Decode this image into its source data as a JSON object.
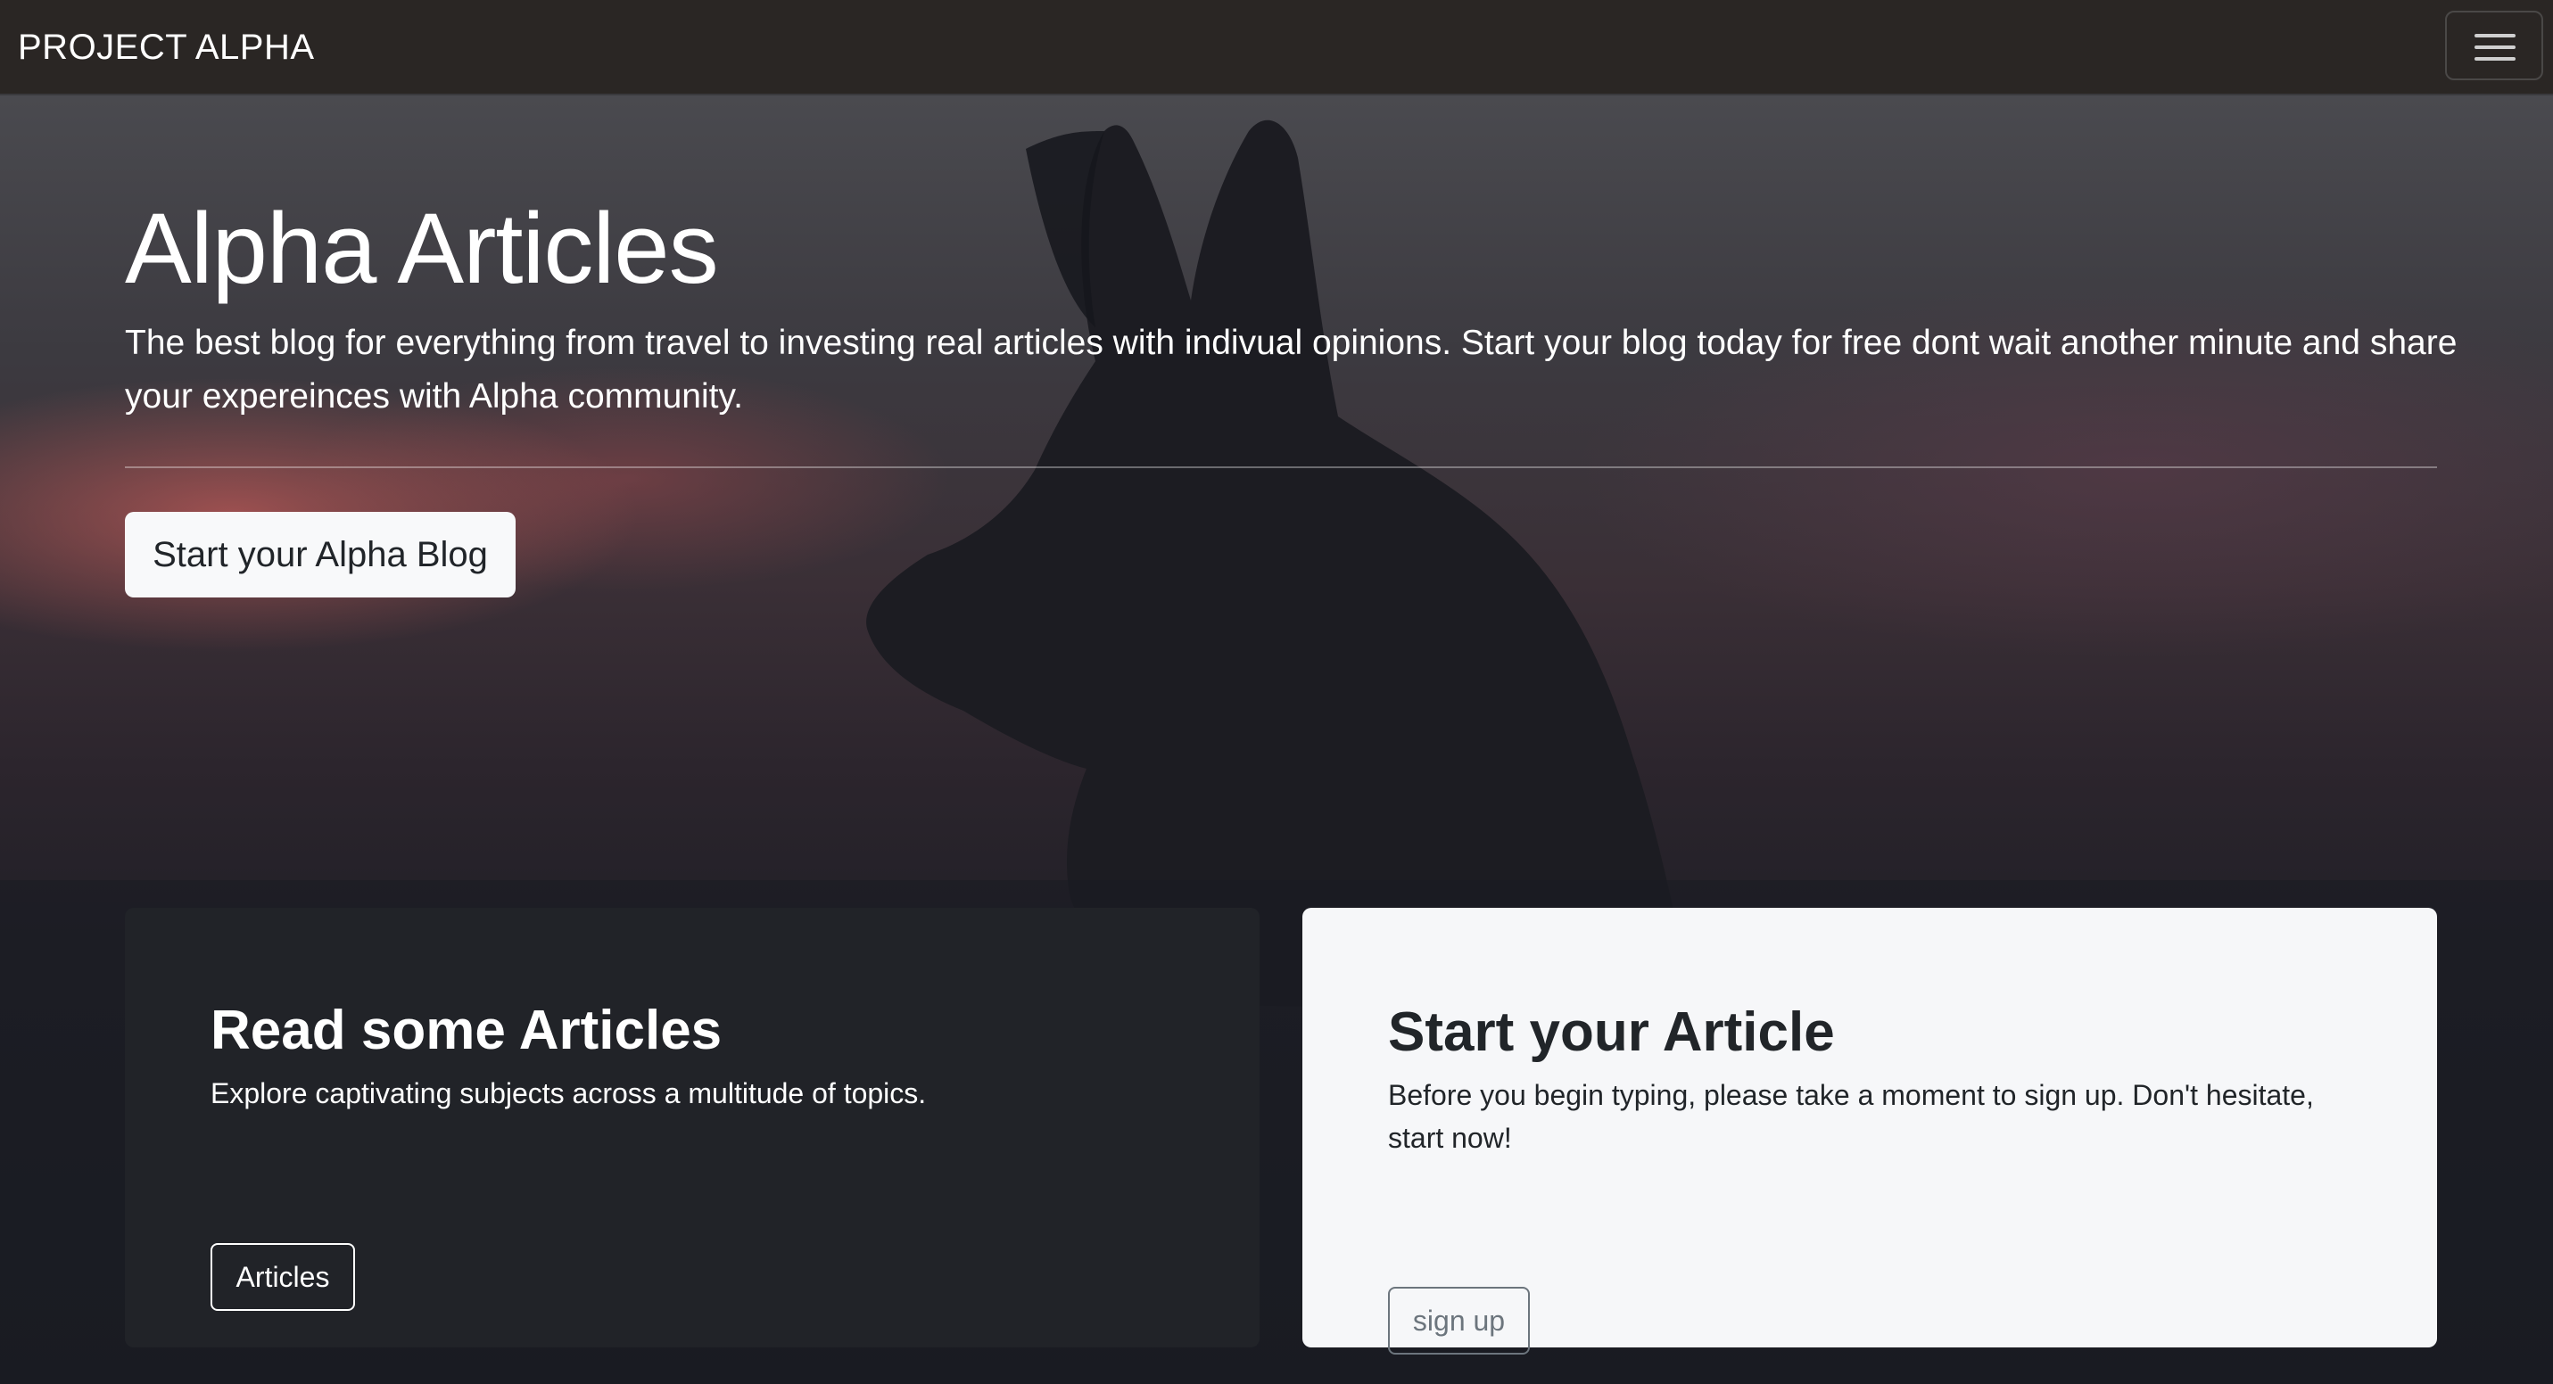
{
  "navbar": {
    "brand": "PROJECT ALPHA",
    "menu_icon": "hamburger-menu-icon"
  },
  "hero": {
    "title": "Alpha Articles",
    "lead": "The best blog for everything from travel to investing real articles with indivual opinions. Start your blog today for free dont wait another minute and share your expereinces with Alpha community.",
    "cta_label": "Start your Alpha Blog",
    "background_image": "wolf-silhouette-at-sunset"
  },
  "cards": {
    "read": {
      "title": "Read some Articles",
      "text": "Explore captivating subjects across a multitude of topics.",
      "button_label": "Articles"
    },
    "start": {
      "title": "Start your Article",
      "text": "Before you begin typing, please take a moment to sign up. Don't hesitate, start now!",
      "button_label": "sign up"
    }
  },
  "colors": {
    "navbar_bg": "#2a2624",
    "dark_card_bg": "#212328",
    "light_card_bg": "#f6f7f9",
    "muted_button": "#6c757d"
  }
}
